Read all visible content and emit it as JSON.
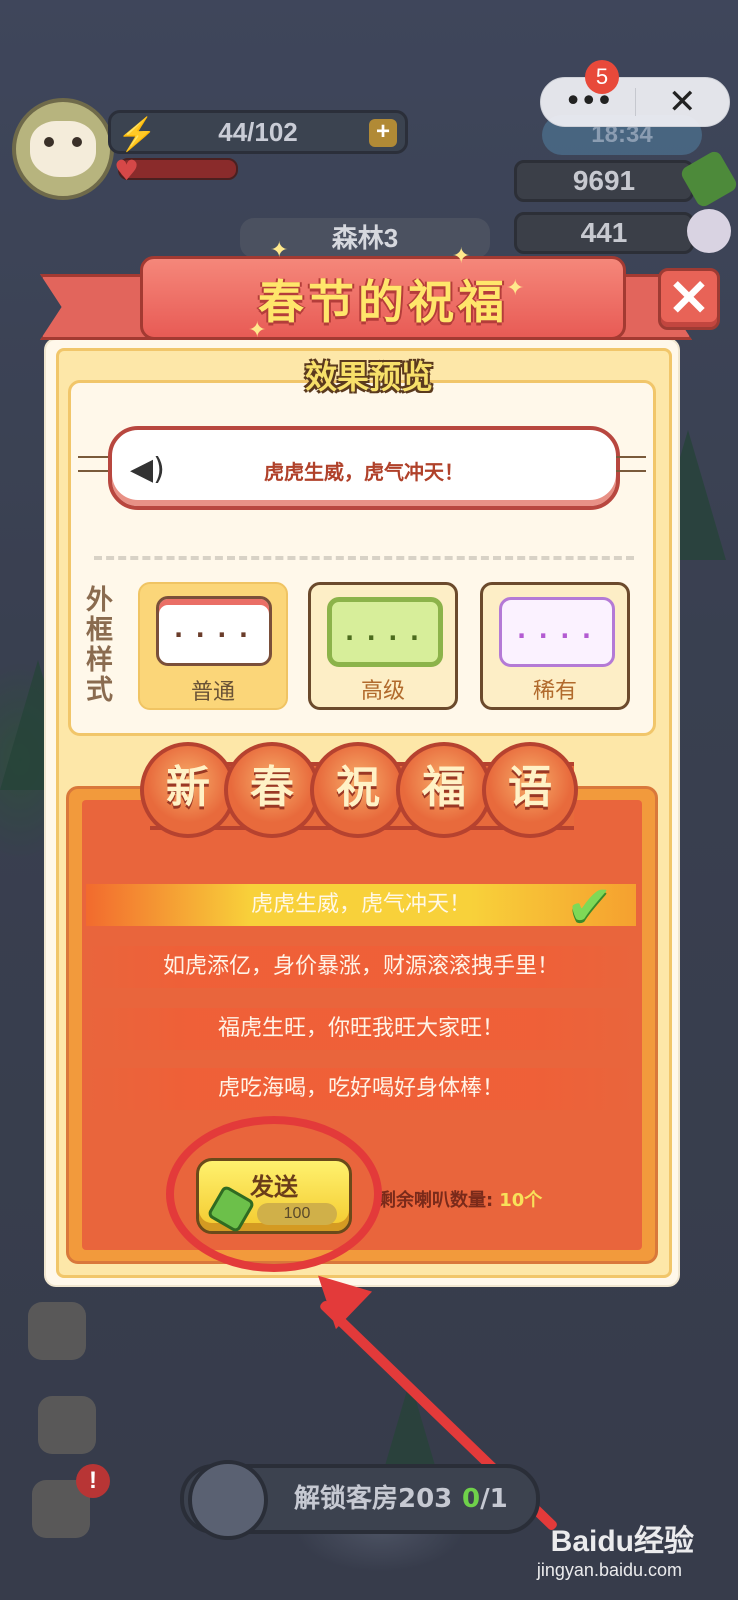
{
  "hud": {
    "energy": "44/102",
    "energy_plus": "+",
    "time": "18:34",
    "bamboo_count": "9691",
    "pearl_count": "441",
    "area_name": "森林3",
    "menu_badge": "5",
    "more_label": "•••",
    "close_label": "✕"
  },
  "dialog": {
    "title": "春节的祝福",
    "close_label": "✕",
    "preview_heading": "效果预览",
    "preview_message": "虎虎生威，虎气冲天！",
    "frame_style_label": "外框样式",
    "frame_styles": [
      {
        "label": "普通",
        "dots": "....",
        "selected": true
      },
      {
        "label": "高级",
        "dots": "....",
        "selected": false
      },
      {
        "label": "稀有",
        "dots": "....",
        "selected": false
      }
    ],
    "wishes_heading": [
      "新",
      "春",
      "祝",
      "福",
      "语"
    ],
    "wishes": [
      {
        "text": "虎虎生威，虎气冲天！",
        "selected": true
      },
      {
        "text": "如虎添亿，身价暴涨，财源滚滚拽手里！",
        "selected": false
      },
      {
        "text": "福虎生旺，你旺我旺大家旺！",
        "selected": false
      },
      {
        "text": "虎吃海喝，吃好喝好身体棒！",
        "selected": false
      }
    ],
    "send_label": "发送",
    "send_cost": "100",
    "remaining_label": "剩余喇叭数量:",
    "remaining_value": "10个"
  },
  "bottom": {
    "unlock_label": "解锁客房203",
    "unlock_progress_current": "0",
    "unlock_progress_total": "/1",
    "alert": "!"
  },
  "watermark": {
    "brand": "Baidu经验",
    "url": "jingyan.baidu.com"
  },
  "colors": {
    "accent_red": "#e85b55",
    "title_yellow": "#ffe66b",
    "panel_orange": "#e9653c",
    "annotation_red": "#e33a3a"
  }
}
